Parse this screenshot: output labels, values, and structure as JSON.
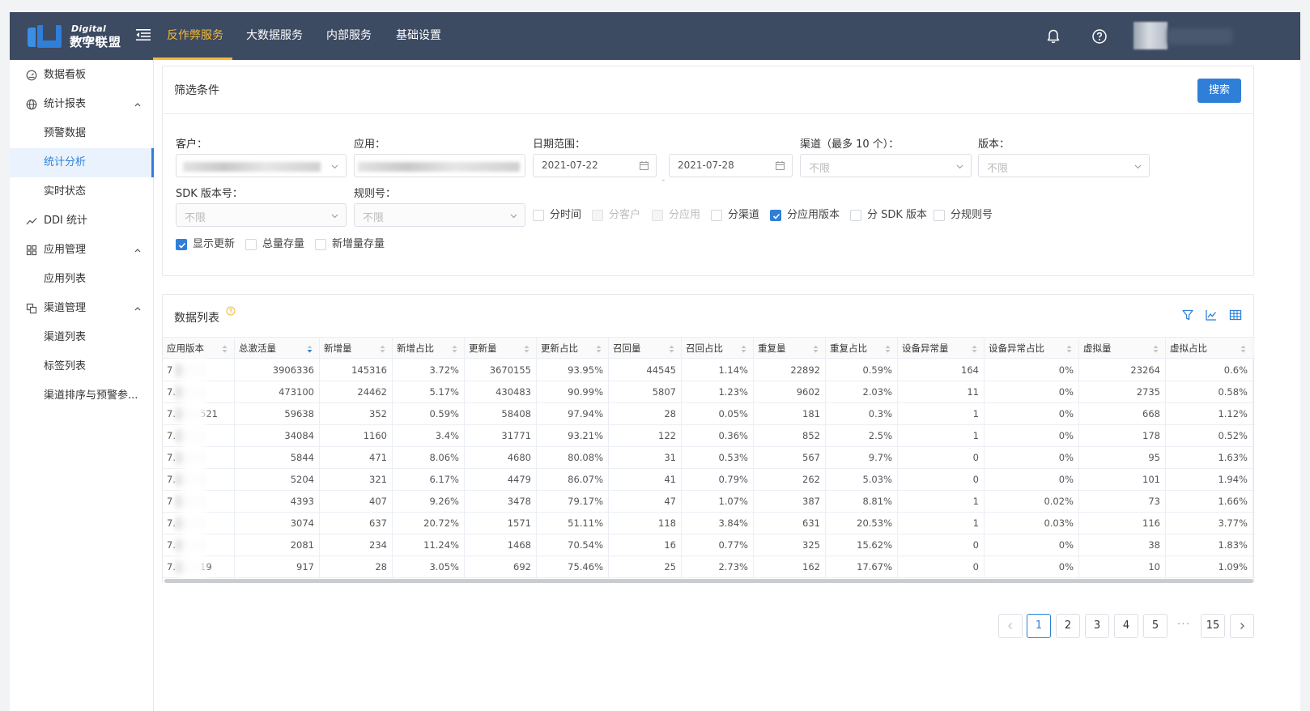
{
  "header": {
    "logo_en": "Digital Union",
    "logo_cn": "数字联盟",
    "nav": [
      {
        "label": "反作弊服务",
        "active": true
      },
      {
        "label": "大数据服务",
        "active": false
      },
      {
        "label": "内部服务",
        "active": false
      },
      {
        "label": "基础设置",
        "active": false
      }
    ],
    "icons": [
      "bell-icon",
      "help-icon"
    ]
  },
  "sidebar": {
    "items": [
      {
        "label": "数据看板",
        "icon": "dashboard-icon",
        "level": 1
      },
      {
        "label": "统计报表",
        "icon": "globe-icon",
        "level": 1,
        "expanded": true
      },
      {
        "label": "预警数据",
        "level": 2
      },
      {
        "label": "统计分析",
        "level": 2,
        "active": true
      },
      {
        "label": "实时状态",
        "level": 2
      },
      {
        "label": "DDI 统计",
        "icon": "trend-icon",
        "level": 1
      },
      {
        "label": "应用管理",
        "icon": "grid-icon",
        "level": 1,
        "expanded": true
      },
      {
        "label": "应用列表",
        "level": 2
      },
      {
        "label": "渠道管理",
        "icon": "copy-icon",
        "level": 1,
        "expanded": true
      },
      {
        "label": "渠道列表",
        "level": 2
      },
      {
        "label": "标签列表",
        "level": 2
      },
      {
        "label": "渠道排序与预警参...",
        "level": 2
      }
    ]
  },
  "filter": {
    "title": "筛选条件",
    "search_label": "搜索",
    "customer_label": "客户：",
    "app_label": "应用：",
    "date_label": "日期范围：",
    "date_start": "2021-07-22",
    "date_sep": "-",
    "date_end": "2021-07-28",
    "channel_label": "渠道（最多 10 个）：",
    "channel_placeholder": "不限",
    "version_label": "版本：",
    "version_placeholder": "不限",
    "sdk_label": "SDK 版本号：",
    "sdk_placeholder": "不限",
    "rule_label": "规则号：",
    "rule_placeholder": "不限",
    "checks_row1": [
      {
        "label": "分时间",
        "checked": false,
        "disabled": false
      },
      {
        "label": "分客户",
        "checked": false,
        "disabled": true
      },
      {
        "label": "分应用",
        "checked": false,
        "disabled": true
      },
      {
        "label": "分渠道",
        "checked": false,
        "disabled": false
      },
      {
        "label": "分应用版本",
        "checked": true,
        "disabled": false
      },
      {
        "label": "分 SDK 版本",
        "checked": false,
        "disabled": false
      },
      {
        "label": "分规则号",
        "checked": false,
        "disabled": false
      }
    ],
    "checks_row2": [
      {
        "label": "显示更新",
        "checked": true
      },
      {
        "label": "总量存量",
        "checked": false
      },
      {
        "label": "新增量存量",
        "checked": false
      }
    ]
  },
  "data": {
    "title": "数据列表",
    "columns": [
      "应用版本",
      "总激活量",
      "新增量",
      "新增占比",
      "更新量",
      "更新占比",
      "召回量",
      "召回占比",
      "重复量",
      "重复占比",
      "设备异常量",
      "设备异常占比",
      "虚拟量",
      "虚拟占比"
    ],
    "rows": [
      {
        "ver": "7",
        "suffix": "",
        "vals": [
          "3906336",
          "145316",
          "3.72%",
          "3670155",
          "93.95%",
          "44545",
          "1.14%",
          "22892",
          "0.59%",
          "164",
          "0%",
          "23264",
          "0.6%"
        ]
      },
      {
        "ver": "7.",
        "suffix": "",
        "vals": [
          "473100",
          "24462",
          "5.17%",
          "430483",
          "90.99%",
          "5807",
          "1.23%",
          "9602",
          "2.03%",
          "11",
          "0%",
          "2735",
          "0.58%"
        ]
      },
      {
        "ver": "7.",
        "suffix": "521",
        "vals": [
          "59638",
          "352",
          "0.59%",
          "58408",
          "97.94%",
          "28",
          "0.05%",
          "181",
          "0.3%",
          "1",
          "0%",
          "668",
          "1.12%"
        ]
      },
      {
        "ver": "7.",
        "suffix": "",
        "vals": [
          "34084",
          "1160",
          "3.4%",
          "31771",
          "93.21%",
          "122",
          "0.36%",
          "852",
          "2.5%",
          "1",
          "0%",
          "178",
          "0.52%"
        ]
      },
      {
        "ver": "7.",
        "suffix": "",
        "vals": [
          "5844",
          "471",
          "8.06%",
          "4680",
          "80.08%",
          "31",
          "0.53%",
          "567",
          "9.7%",
          "0",
          "0%",
          "95",
          "1.63%"
        ]
      },
      {
        "ver": "7.",
        "suffix": "",
        "vals": [
          "5204",
          "321",
          "6.17%",
          "4479",
          "86.07%",
          "41",
          "0.79%",
          "262",
          "5.03%",
          "0",
          "0%",
          "101",
          "1.94%"
        ]
      },
      {
        "ver": "7",
        "suffix": "",
        "vals": [
          "4393",
          "407",
          "9.26%",
          "3478",
          "79.17%",
          "47",
          "1.07%",
          "387",
          "8.81%",
          "1",
          "0.02%",
          "73",
          "1.66%"
        ]
      },
      {
        "ver": "7.",
        "suffix": "",
        "vals": [
          "3074",
          "637",
          "20.72%",
          "1571",
          "51.11%",
          "118",
          "3.84%",
          "631",
          "20.53%",
          "1",
          "0.03%",
          "116",
          "3.77%"
        ]
      },
      {
        "ver": "7.",
        "suffix": "",
        "vals": [
          "2081",
          "234",
          "11.24%",
          "1468",
          "70.54%",
          "16",
          "0.77%",
          "325",
          "15.62%",
          "0",
          "0%",
          "38",
          "1.83%"
        ]
      },
      {
        "ver": "7.",
        "suffix": "19",
        "vals": [
          "917",
          "28",
          "3.05%",
          "692",
          "75.46%",
          "25",
          "2.73%",
          "162",
          "17.67%",
          "0",
          "0%",
          "10",
          "1.09%"
        ]
      }
    ]
  },
  "pagination": {
    "pages": [
      "1",
      "2",
      "3",
      "4",
      "5"
    ],
    "ellipsis": "···",
    "last": "15",
    "current": "1"
  },
  "colors": {
    "header_bg": "#3c4a62",
    "accent": "#2f7fd9",
    "nav_active": "#f5b935"
  }
}
